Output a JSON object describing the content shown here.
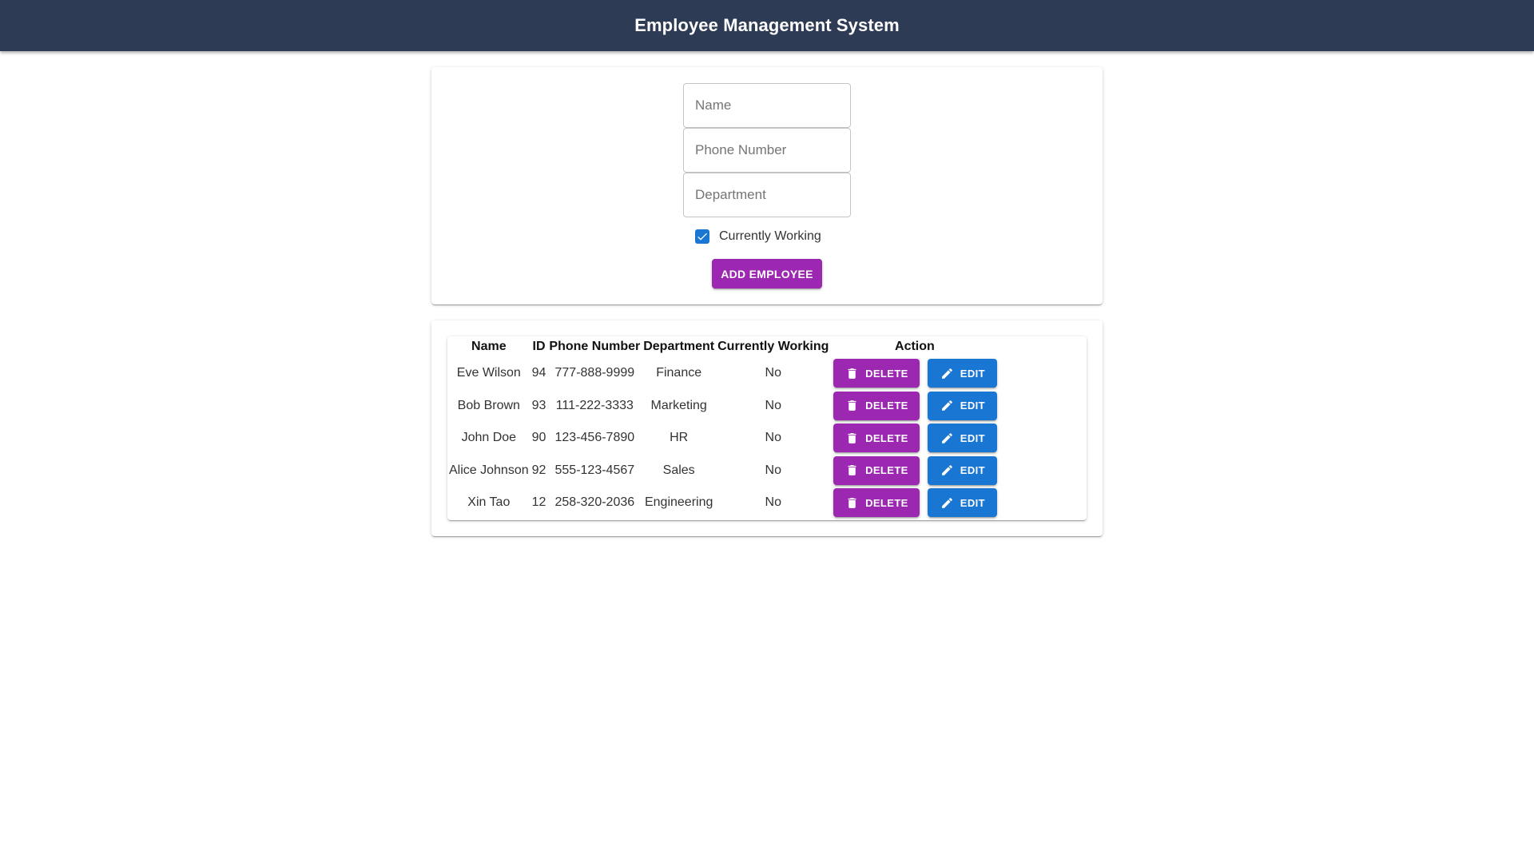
{
  "header": {
    "title": "Employee Management System"
  },
  "form": {
    "name_placeholder": "Name",
    "phone_placeholder": "Phone Number",
    "department_placeholder": "Department",
    "currently_working_label": "Currently Working",
    "currently_working_checked": true,
    "add_button_label": "ADD EMPLOYEE"
  },
  "table": {
    "headers": {
      "name": "Name",
      "id": "ID",
      "phone": "Phone Number",
      "department": "Department",
      "working": "Currently Working",
      "action": "Action"
    },
    "rows": [
      {
        "name": "Eve Wilson",
        "id": "94",
        "phone": "777-888-9999",
        "department": "Finance",
        "working": "No",
        "delete_label": "DELETE",
        "edit_label": "EDIT"
      },
      {
        "name": "Bob Brown",
        "id": "93",
        "phone": "111-222-3333",
        "department": "Marketing",
        "working": "No",
        "delete_label": "DELETE",
        "edit_label": "EDIT"
      },
      {
        "name": "John Doe",
        "id": "90",
        "phone": "123-456-7890",
        "department": "HR",
        "working": "No",
        "delete_label": "DELETE",
        "edit_label": "EDIT"
      },
      {
        "name": "Alice Johnson",
        "id": "92",
        "phone": "555-123-4567",
        "department": "Sales",
        "working": "No",
        "delete_label": "DELETE",
        "edit_label": "EDIT"
      },
      {
        "name": "Xin Tao",
        "id": "12",
        "phone": "258-320-2036",
        "department": "Engineering",
        "working": "No",
        "delete_label": "DELETE",
        "edit_label": "EDIT"
      }
    ]
  },
  "icons": {
    "delete": "trash-icon",
    "edit": "pencil-icon",
    "checkbox": "check-icon"
  },
  "colors": {
    "appbar": "#2e3b55",
    "primary_purple": "#9c27b0",
    "primary_blue": "#1976d2"
  }
}
